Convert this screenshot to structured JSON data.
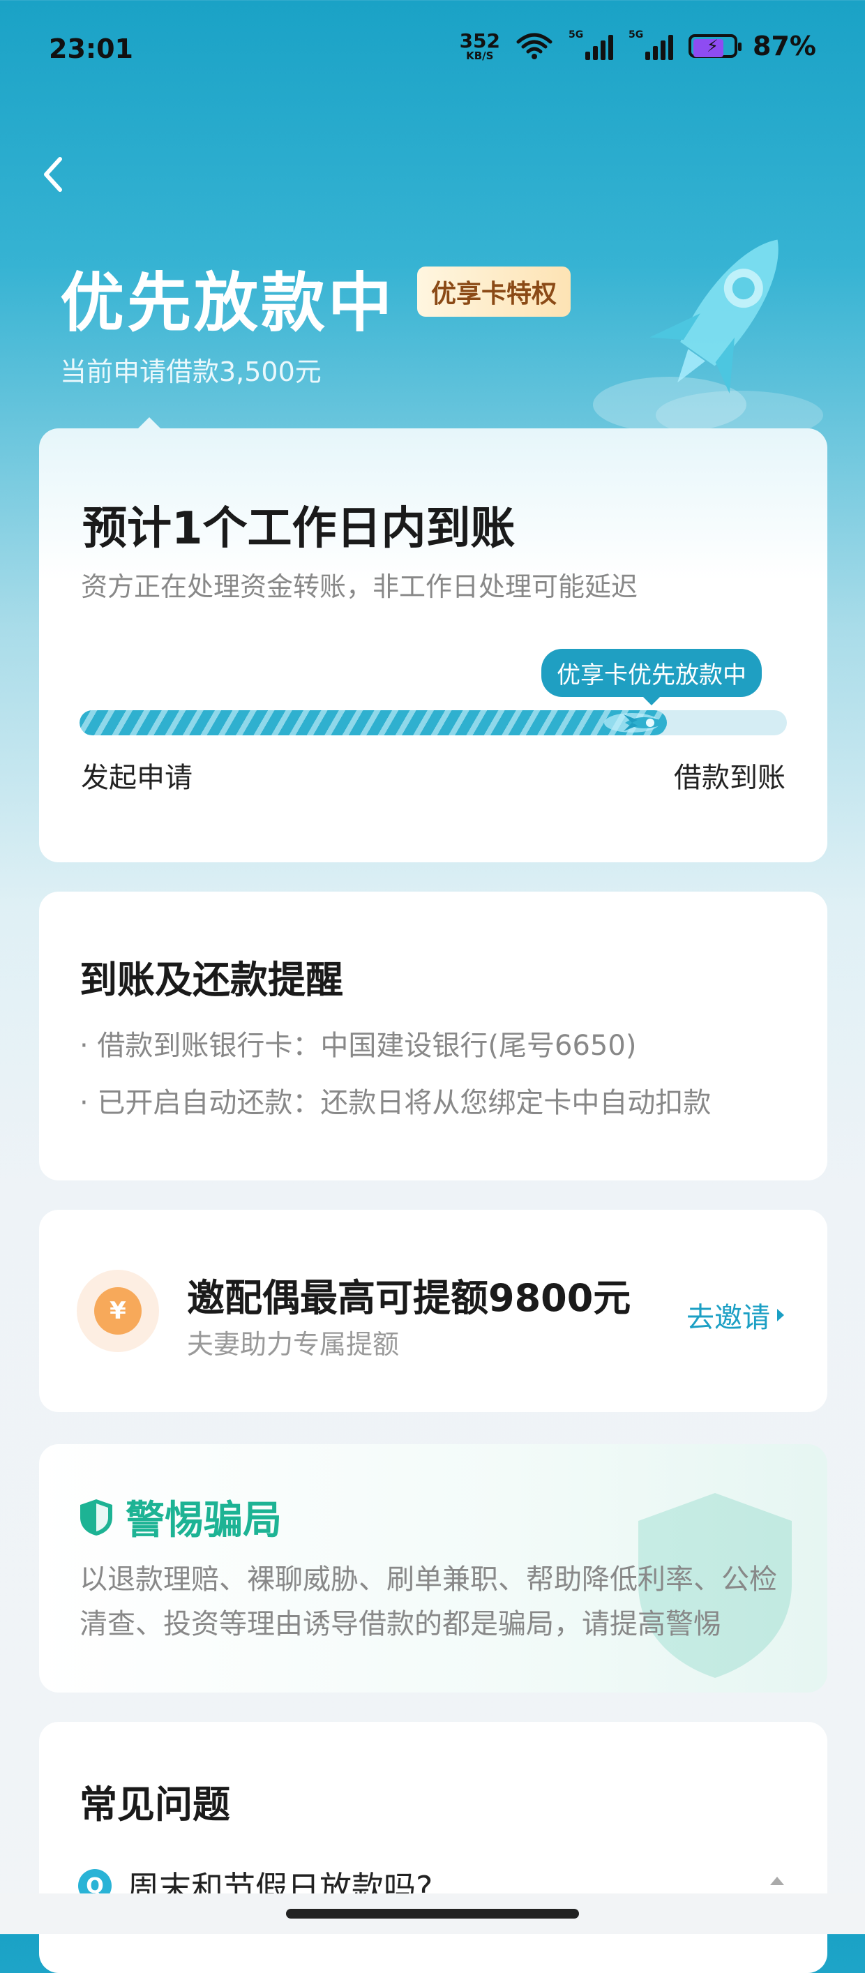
{
  "status_bar": {
    "time": "23:01",
    "net_speed_value": "352",
    "net_speed_unit": "KB/S",
    "signal_1_tag": "5G",
    "signal_2_tag": "5G",
    "battery_percent": "87%",
    "battery_level": 0.87,
    "icons": [
      "wifi-icon",
      "signal-icon",
      "battery-charging-icon"
    ]
  },
  "header": {
    "title": "优先放款中",
    "badge": "优享卡特权",
    "subtitle": "当前申请借款3,500元"
  },
  "progress_card": {
    "title": "预计1个工作日内到账",
    "description": "资方正在处理资金转账，非工作日处理可能延迟",
    "tooltip": "优享卡优先放款中",
    "progress": 0.83,
    "start_label": "发起申请",
    "end_label": "借款到账"
  },
  "reminder_card": {
    "title": "到账及还款提醒",
    "items": [
      "· 借款到账银行卡：中国建设银行(尾号6650)",
      "· 已开启自动还款：还款日将从您绑定卡中自动扣款"
    ]
  },
  "invite_card": {
    "coin_symbol": "¥",
    "title": "邀配偶最高可提额9800元",
    "subtitle": "夫妻助力专属提额",
    "action": "去邀请"
  },
  "warning_card": {
    "title": "警惕骗局",
    "text": "以退款理赔、裸聊威胁、刷单兼职、帮助降低利率、公检清查、投资等理由诱导借款的都是骗局，请提高警惕"
  },
  "faq_card": {
    "title": "常见问题",
    "badge": "Q",
    "question": "周末和节假日放款吗?"
  },
  "colors": {
    "brand": "#1f9fc2",
    "warning_green": "#1db394",
    "coin_orange": "#f7a95a",
    "badge_gold": "#8b4a16"
  }
}
